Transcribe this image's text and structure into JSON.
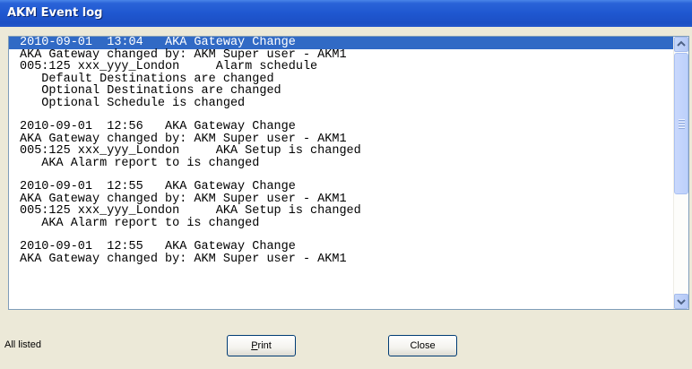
{
  "window": {
    "title": "AKM Event log"
  },
  "log": {
    "lines": [
      "2010-09-01  13:04   AKA Gateway Change",
      "AKA Gateway changed by: AKM Super user - AKM1",
      "005:125 xxx_yyy_London     Alarm schedule",
      "   Default Destinations are changed",
      "   Optional Destinations are changed",
      "   Optional Schedule is changed",
      "",
      "2010-09-01  12:56   AKA Gateway Change",
      "AKA Gateway changed by: AKM Super user - AKM1",
      "005:125 xxx_yyy_London     AKA Setup is changed",
      "   AKA Alarm report to is changed",
      "",
      "2010-09-01  12:55   AKA Gateway Change",
      "AKA Gateway changed by: AKM Super user - AKM1",
      "005:125 xxx_yyy_London     AKA Setup is changed",
      "   AKA Alarm report to is changed",
      "",
      "2010-09-01  12:55   AKA Gateway Change",
      "AKA Gateway changed by: AKM Super user - AKM1"
    ],
    "selected_index": 0
  },
  "scrollbar": {
    "up_icon": "scroll-up-arrow-icon",
    "down_icon": "scroll-down-arrow-icon"
  },
  "footer": {
    "status": "All listed",
    "print_prefix": "",
    "print_underlined": "P",
    "print_rest": "rint",
    "close_label": "Close"
  },
  "colors": {
    "title_bar": "#1f57d0",
    "selection": "#316ac5",
    "dialog_bg": "#ece9d8"
  }
}
